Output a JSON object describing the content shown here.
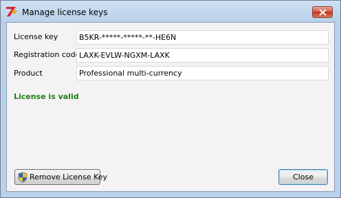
{
  "window": {
    "title": "Manage license keys",
    "icon": "app-logo-icon",
    "close_icon": "close-icon"
  },
  "form": {
    "license_key": {
      "label": "License key",
      "value": "B5KR-*****-*****-**-HE6N"
    },
    "registration_code": {
      "label": "Registration code",
      "value": "LAXK-EVLW-NGXM-LAXK"
    },
    "product": {
      "label": "Product",
      "value": "Professional multi-currency"
    }
  },
  "status": {
    "text": "License is valid",
    "color": "#1e7f13"
  },
  "buttons": {
    "remove_label": "Remove License Key",
    "remove_icon": "uac-shield-icon",
    "close_label": "Close"
  }
}
